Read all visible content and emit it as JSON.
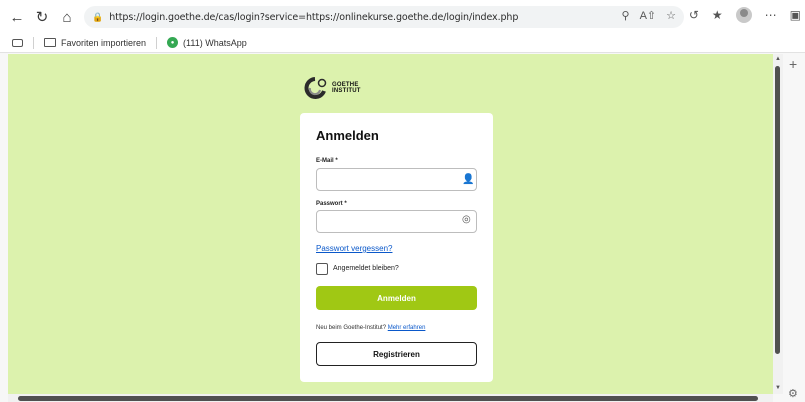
{
  "browser": {
    "url": "https://login.goethe.de/cas/login?service=https://onlinekurse.goethe.de/login/index.php",
    "favorites": [
      {
        "label": "Favoriten importieren"
      },
      {
        "label": "(111) WhatsApp"
      }
    ]
  },
  "logo": {
    "line1": "GOETHE",
    "line2": "INSTITUT"
  },
  "login": {
    "title": "Anmelden",
    "email_label": "E-Mail *",
    "email_value": "",
    "password_label": "Passwort *",
    "password_value": "",
    "forgot_link": "Passwort vergessen?",
    "remember_label": "Angemeldet bleiben?",
    "submit_label": "Anmelden",
    "new_text": "Neu beim Goethe-Institut?",
    "new_link": "Mehr erfahren",
    "register_label": "Registrieren"
  },
  "colors": {
    "page_background": "#dcf2ad",
    "primary_button": "#a0c814",
    "link": "#0a58ca"
  }
}
